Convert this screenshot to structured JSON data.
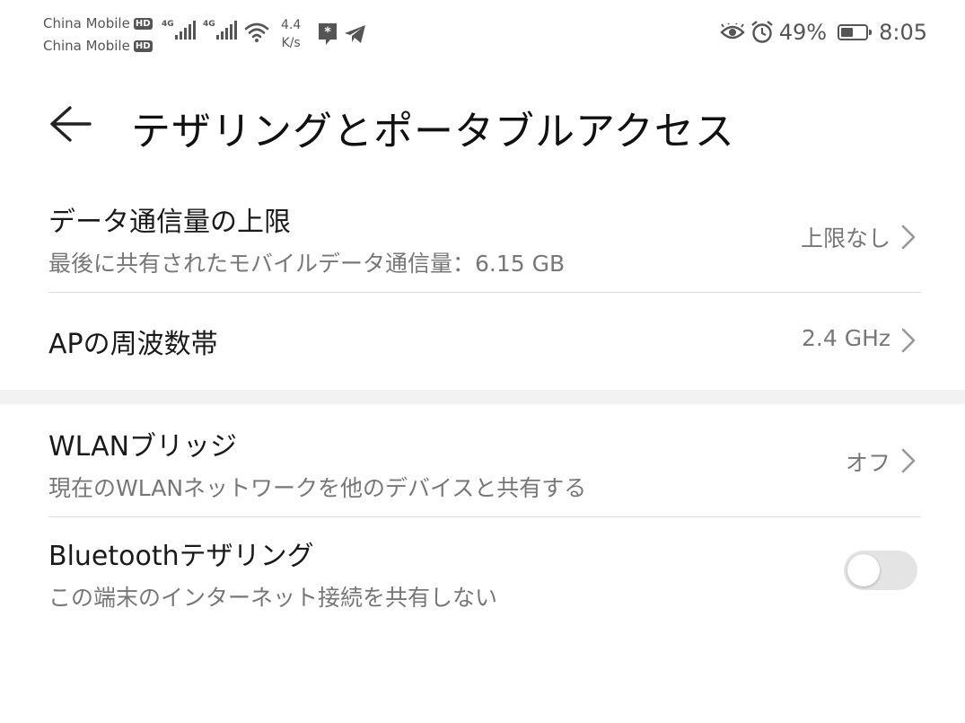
{
  "status_bar": {
    "carrier1": "China Mobile",
    "carrier2": "China Mobile",
    "hd_badge": "HD",
    "network_type": "4G",
    "speed_value": "4.4",
    "speed_unit": "K/s",
    "battery_percent": "49%",
    "battery_level": 0.49,
    "time": "8:05",
    "icons": [
      "signal-icon",
      "wifi-icon",
      "app-notification-icon",
      "telegram-icon",
      "eye-comfort-icon",
      "alarm-icon",
      "battery-icon"
    ]
  },
  "header": {
    "title": "テザリングとポータブルアクセス",
    "back_icon": "back-arrow-icon"
  },
  "settings": {
    "data_limit": {
      "label": "データ通信量の上限",
      "description": "最後に共有されたモバイルデータ通信量：6.15 GB",
      "value": "上限なし"
    },
    "ap_band": {
      "label": "APの周波数帯",
      "value": "2.4 GHz"
    },
    "wlan_bridge": {
      "label": "WLANブリッジ",
      "description": "現在のWLANネットワークを他のデバイスと共有する",
      "value": "オフ"
    },
    "bluetooth_tethering": {
      "label": "Bluetoothテザリング",
      "description": "この端末のインターネット接続を共有しない",
      "enabled": false
    }
  },
  "colors": {
    "text_primary": "#1a1a1a",
    "text_secondary": "#777777",
    "divider": "#dcdcdc",
    "section_gap": "#f2f2f2",
    "toggle_off": "#e4e4e4"
  }
}
